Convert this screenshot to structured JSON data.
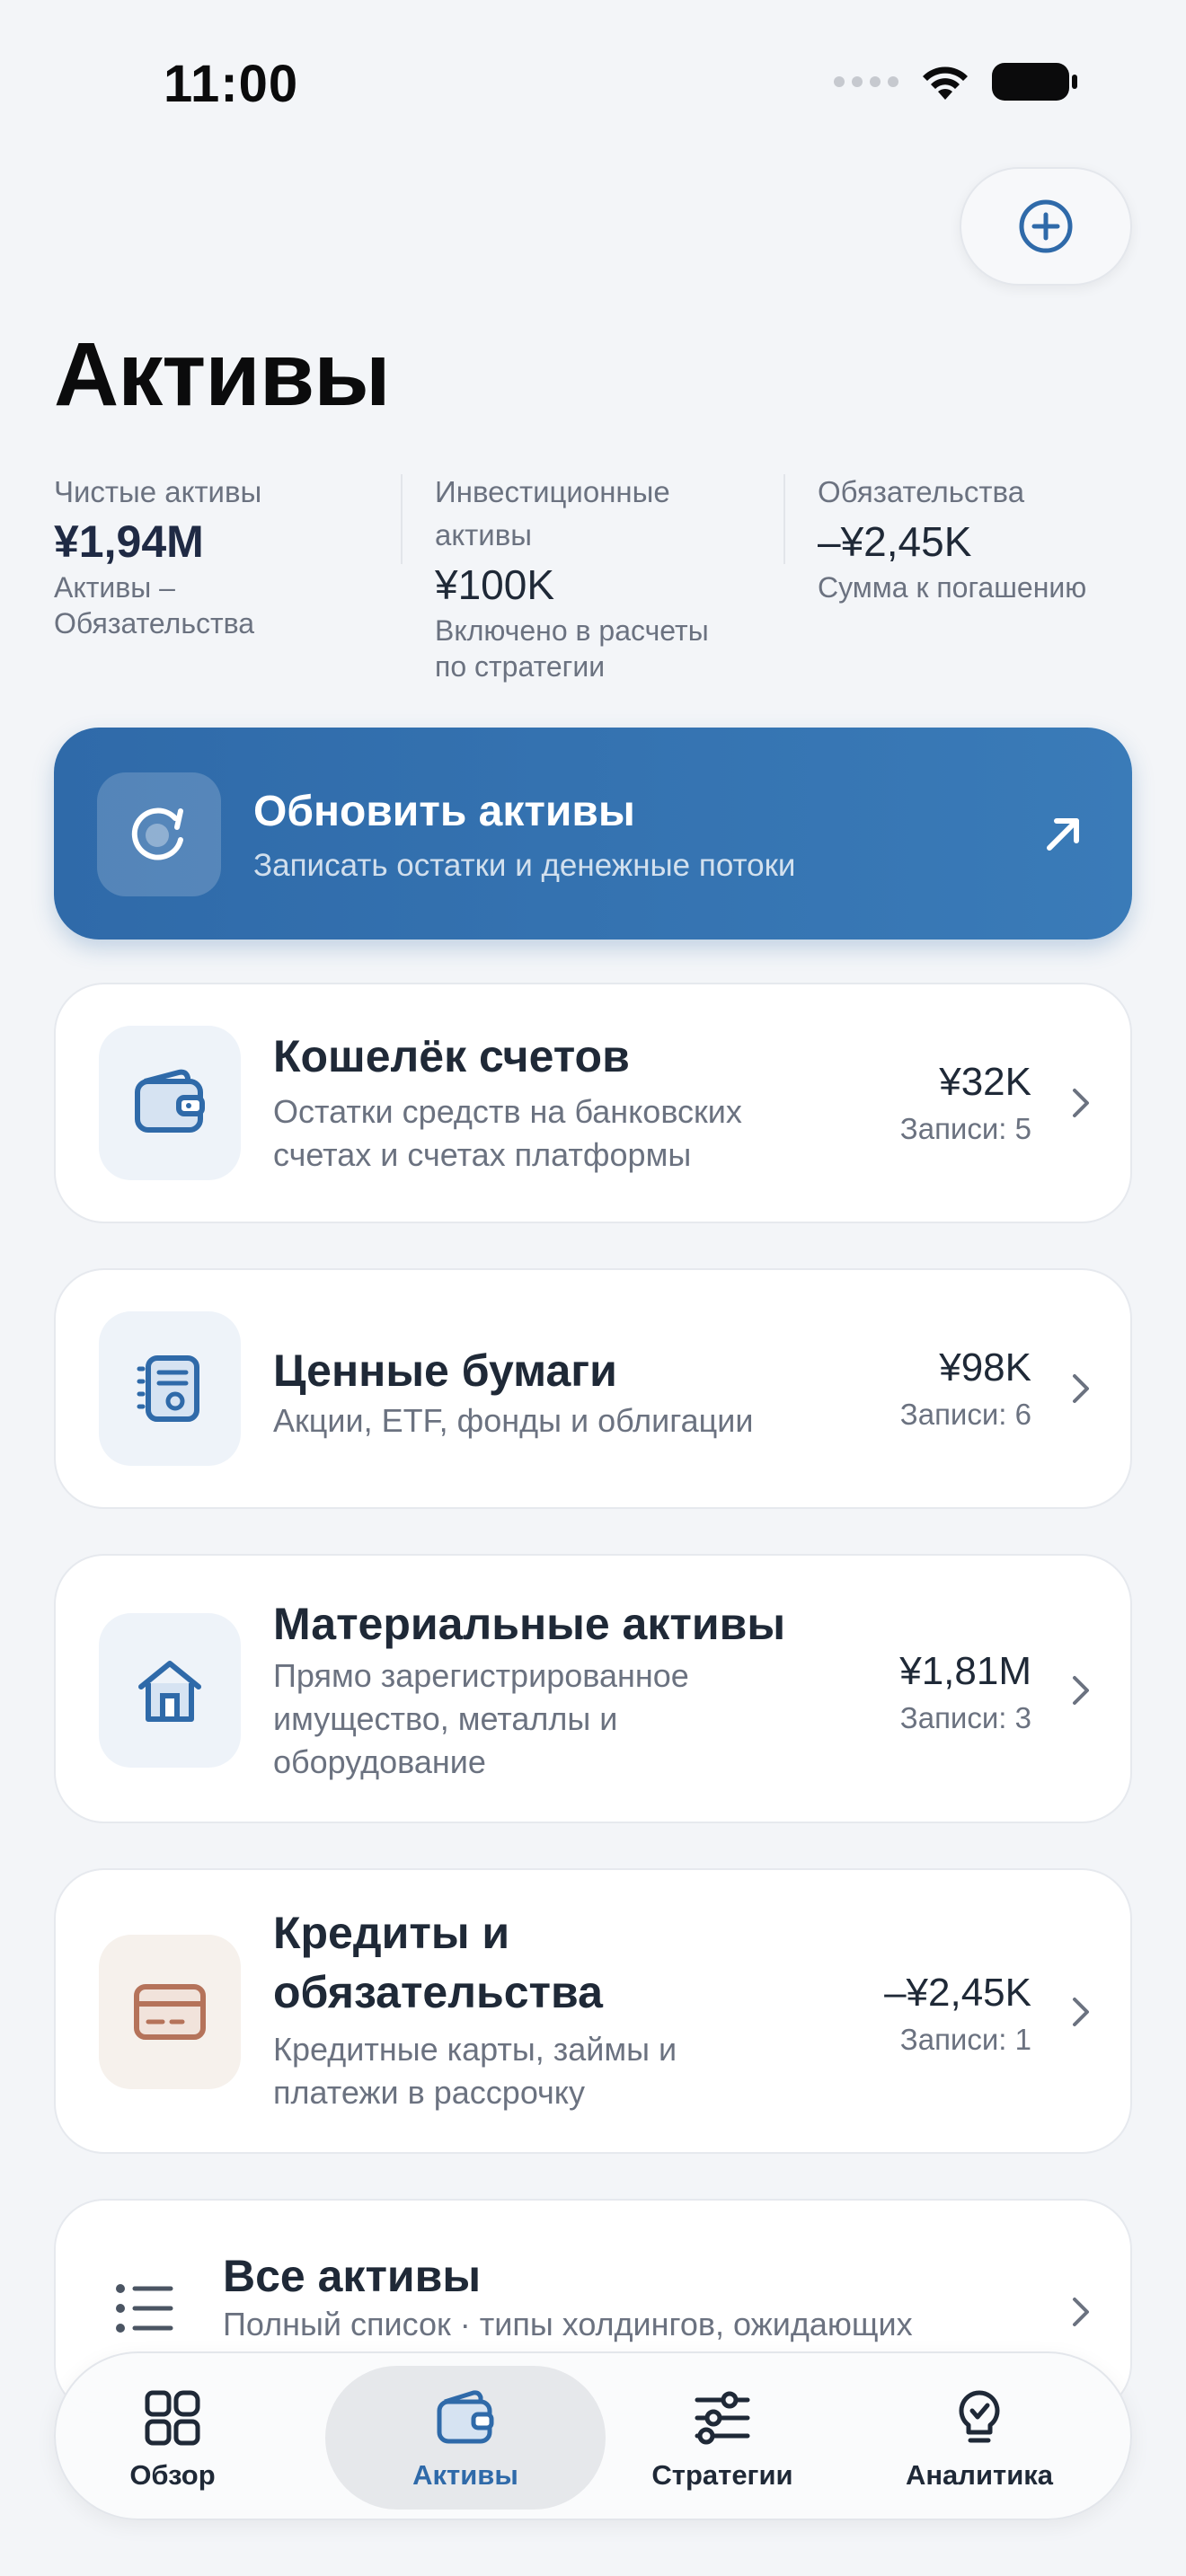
{
  "status_bar": {
    "time": "11:00"
  },
  "header": {
    "title": "Активы"
  },
  "summary": {
    "net": {
      "label": "Чистые активы",
      "value": "¥1,94M",
      "sub_line1": "Активы –",
      "sub_line2": "Обязательства"
    },
    "investment": {
      "label_line1": "Инвестиционные",
      "label_line2": "активы",
      "value": "¥100K",
      "sub_line1": "Включено в расчеты",
      "sub_line2": "по стратегии"
    },
    "liabilities": {
      "label": "Обязательства",
      "value": "–¥2,45K",
      "sub": "Сумма к погашению"
    }
  },
  "update_banner": {
    "title": "Обновить активы",
    "subtitle": "Записать остатки и денежные потоки"
  },
  "categories": [
    {
      "title": "Кошелёк счетов",
      "desc_line1": "Остатки средств на банковских",
      "desc_line2": "счетах и счетах платформы",
      "amount": "¥32K",
      "count": "Записи: 5",
      "icon": "wallet-icon"
    },
    {
      "title": "Ценные бумаги",
      "desc_line1": "Акции, ETF, фонды и облигации",
      "amount": "¥98K",
      "count": "Записи: 6",
      "icon": "document-icon"
    },
    {
      "title": "Материальные активы",
      "desc_line1": "Прямо зарегистрированное",
      "desc_line2": "имущество, металлы и",
      "desc_line3": "оборудование",
      "amount": "¥1,81M",
      "count": "Записи: 3",
      "icon": "house-icon"
    },
    {
      "title_line1": "Кредиты и",
      "title_line2": "обязательства",
      "desc_line1": "Кредитные карты, займы и",
      "desc_line2": "платежи в рассрочку",
      "amount": "–¥2,45K",
      "count": "Записи: 1",
      "icon": "credit-card-icon"
    }
  ],
  "all_assets": {
    "title": "Все активы",
    "subtitle": "Полный список · типы холдингов, ожидающих"
  },
  "nav": [
    {
      "label": "Обзор",
      "icon": "grid-icon"
    },
    {
      "label": "Активы",
      "icon": "wallet-icon",
      "active": true
    },
    {
      "label": "Стратегии",
      "icon": "sliders-icon"
    },
    {
      "label": "Аналитика",
      "icon": "lightbulb-icon"
    }
  ],
  "colors": {
    "accent": "#2f6aa9",
    "liability": "#b5735a"
  }
}
